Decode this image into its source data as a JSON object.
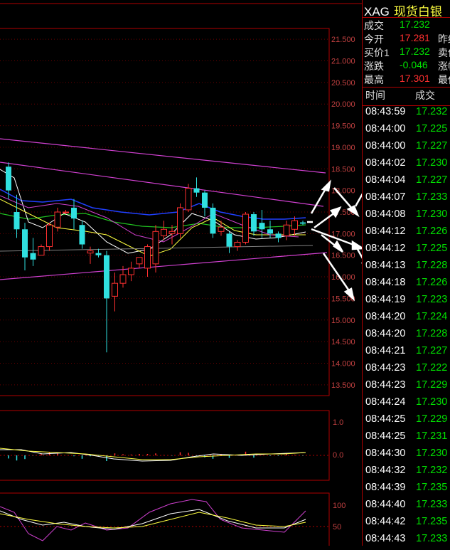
{
  "chart": {
    "price_axis_labels": [
      "21.500",
      "21.000",
      "20.500",
      "20.000",
      "19.500",
      "19.000",
      "18.500",
      "18.000",
      "17.500",
      "17.000",
      "16.500",
      "16.000",
      "15.500",
      "15.000",
      "14.500",
      "14.000",
      "13.500"
    ],
    "macd_axis_labels": [
      "1.0",
      "0.0"
    ],
    "kdj_axis_labels": [
      "100",
      "50"
    ]
  },
  "chart_data": {
    "type": "candlestick",
    "y_axis_labels": [
      "21.500",
      "21.000",
      "20.500",
      "20.000",
      "19.500",
      "19.000",
      "18.500",
      "18.000",
      "17.500",
      "17.000",
      "16.500",
      "16.000",
      "15.500",
      "15.000",
      "14.500",
      "14.000",
      "13.500"
    ],
    "ylim": [
      13.25,
      21.75
    ],
    "candles": [
      {
        "o": 18.55,
        "h": 18.65,
        "l": 17.8,
        "c": 18.0
      },
      {
        "o": 17.5,
        "h": 17.9,
        "l": 16.9,
        "c": 17.1
      },
      {
        "o": 17.1,
        "h": 17.25,
        "l": 16.15,
        "c": 16.45
      },
      {
        "o": 16.55,
        "h": 16.9,
        "l": 16.25,
        "c": 16.4
      },
      {
        "o": 16.5,
        "h": 16.75,
        "l": 16.5,
        "c": 16.7
      },
      {
        "o": 16.7,
        "h": 17.25,
        "l": 16.6,
        "c": 17.2
      },
      {
        "o": 17.15,
        "h": 17.6,
        "l": 17.05,
        "c": 17.5
      },
      {
        "o": 17.5,
        "h": 17.55,
        "l": 17.45,
        "c": 17.5
      },
      {
        "o": 17.6,
        "h": 17.8,
        "l": 17.1,
        "c": 17.35
      },
      {
        "o": 17.2,
        "h": 17.3,
        "l": 16.65,
        "c": 16.75
      },
      {
        "o": 16.55,
        "h": 16.7,
        "l": 16.3,
        "c": 16.6
      },
      {
        "o": 16.55,
        "h": 16.65,
        "l": 16.45,
        "c": 16.5
      },
      {
        "o": 16.5,
        "h": 16.6,
        "l": 14.25,
        "c": 15.5
      },
      {
        "o": 15.55,
        "h": 16.1,
        "l": 15.2,
        "c": 15.85
      },
      {
        "o": 15.85,
        "h": 16.25,
        "l": 15.75,
        "c": 16.05
      },
      {
        "o": 16.05,
        "h": 16.35,
        "l": 15.9,
        "c": 16.2
      },
      {
        "o": 16.3,
        "h": 16.45,
        "l": 16.2,
        "c": 16.45
      },
      {
        "o": 16.2,
        "h": 16.75,
        "l": 16.0,
        "c": 16.7
      },
      {
        "o": 16.3,
        "h": 17.2,
        "l": 16.1,
        "c": 17.05
      },
      {
        "o": 16.95,
        "h": 17.3,
        "l": 16.85,
        "c": 17.1
      },
      {
        "o": 17.0,
        "h": 17.2,
        "l": 16.75,
        "c": 17.05
      },
      {
        "o": 17.0,
        "h": 17.7,
        "l": 16.9,
        "c": 17.6
      },
      {
        "o": 17.55,
        "h": 18.15,
        "l": 17.5,
        "c": 18.05
      },
      {
        "o": 18.05,
        "h": 18.3,
        "l": 17.85,
        "c": 17.95
      },
      {
        "o": 17.95,
        "h": 18.0,
        "l": 17.4,
        "c": 17.6
      },
      {
        "o": 17.6,
        "h": 17.7,
        "l": 16.9,
        "c": 17.0
      },
      {
        "o": 17.05,
        "h": 17.3,
        "l": 16.95,
        "c": 17.15
      },
      {
        "o": 17.0,
        "h": 17.05,
        "l": 16.55,
        "c": 16.7
      },
      {
        "o": 16.7,
        "h": 16.85,
        "l": 16.6,
        "c": 16.8
      },
      {
        "o": 16.8,
        "h": 17.5,
        "l": 16.75,
        "c": 17.45
      },
      {
        "o": 17.45,
        "h": 17.5,
        "l": 16.95,
        "c": 17.05
      },
      {
        "o": 17.25,
        "h": 17.55,
        "l": 16.9,
        "c": 17.1
      },
      {
        "o": 17.1,
        "h": 17.3,
        "l": 16.9,
        "c": 17.0
      },
      {
        "o": 17.0,
        "h": 17.05,
        "l": 16.8,
        "c": 16.9
      },
      {
        "o": 16.95,
        "h": 17.3,
        "l": 16.85,
        "c": 17.2
      },
      {
        "o": 17.1,
        "h": 17.4,
        "l": 16.95,
        "c": 17.3
      },
      {
        "o": 17.26,
        "h": 17.3,
        "l": 17.2,
        "c": 17.23
      }
    ]
  },
  "quote": {
    "symbol": "XAG",
    "name": "现货白银",
    "rows": [
      {
        "label": "成交",
        "value": "17.232",
        "color": "#00e000",
        "label2": ""
      },
      {
        "label": "今开",
        "value": "17.281",
        "color": "#ff3030",
        "label2": "昨结"
      },
      {
        "label": "买价1",
        "value": "17.232",
        "color": "#00e000",
        "label2": "卖价"
      },
      {
        "label": "涨跌",
        "value": "-0.046",
        "color": "#00e000",
        "label2": "涨幅"
      },
      {
        "label": "最高",
        "value": "17.301",
        "color": "#ff3030",
        "label2": "最低"
      }
    ]
  },
  "ticks": {
    "header_time": "时间",
    "header_price": "成交",
    "rows": [
      {
        "time": "08:43:59",
        "price": "17.232"
      },
      {
        "time": "08:44:00",
        "price": "17.225"
      },
      {
        "time": "08:44:00",
        "price": "17.227"
      },
      {
        "time": "08:44:02",
        "price": "17.230"
      },
      {
        "time": "08:44:04",
        "price": "17.227"
      },
      {
        "time": "08:44:07",
        "price": "17.233"
      },
      {
        "time": "08:44:08",
        "price": "17.230"
      },
      {
        "time": "08:44:12",
        "price": "17.226"
      },
      {
        "time": "08:44:12",
        "price": "17.225"
      },
      {
        "time": "08:44:13",
        "price": "17.228"
      },
      {
        "time": "08:44:18",
        "price": "17.226"
      },
      {
        "time": "08:44:19",
        "price": "17.223"
      },
      {
        "time": "08:44:20",
        "price": "17.224"
      },
      {
        "time": "08:44:20",
        "price": "17.228"
      },
      {
        "time": "08:44:21",
        "price": "17.227"
      },
      {
        "time": "08:44:23",
        "price": "17.222"
      },
      {
        "time": "08:44:23",
        "price": "17.229"
      },
      {
        "time": "08:44:24",
        "price": "17.230"
      },
      {
        "time": "08:44:25",
        "price": "17.229"
      },
      {
        "time": "08:44:25",
        "price": "17.231"
      },
      {
        "time": "08:44:30",
        "price": "17.230"
      },
      {
        "time": "08:44:32",
        "price": "17.232"
      },
      {
        "time": "08:44:39",
        "price": "17.235"
      },
      {
        "time": "08:44:40",
        "price": "17.233"
      },
      {
        "time": "08:44:42",
        "price": "17.235"
      },
      {
        "time": "08:44:43",
        "price": "17.233"
      }
    ]
  },
  "colors": {
    "up": "#ff3030",
    "down": "#30e0e0",
    "grid": "#b00000",
    "trendline": "#d040d0"
  }
}
